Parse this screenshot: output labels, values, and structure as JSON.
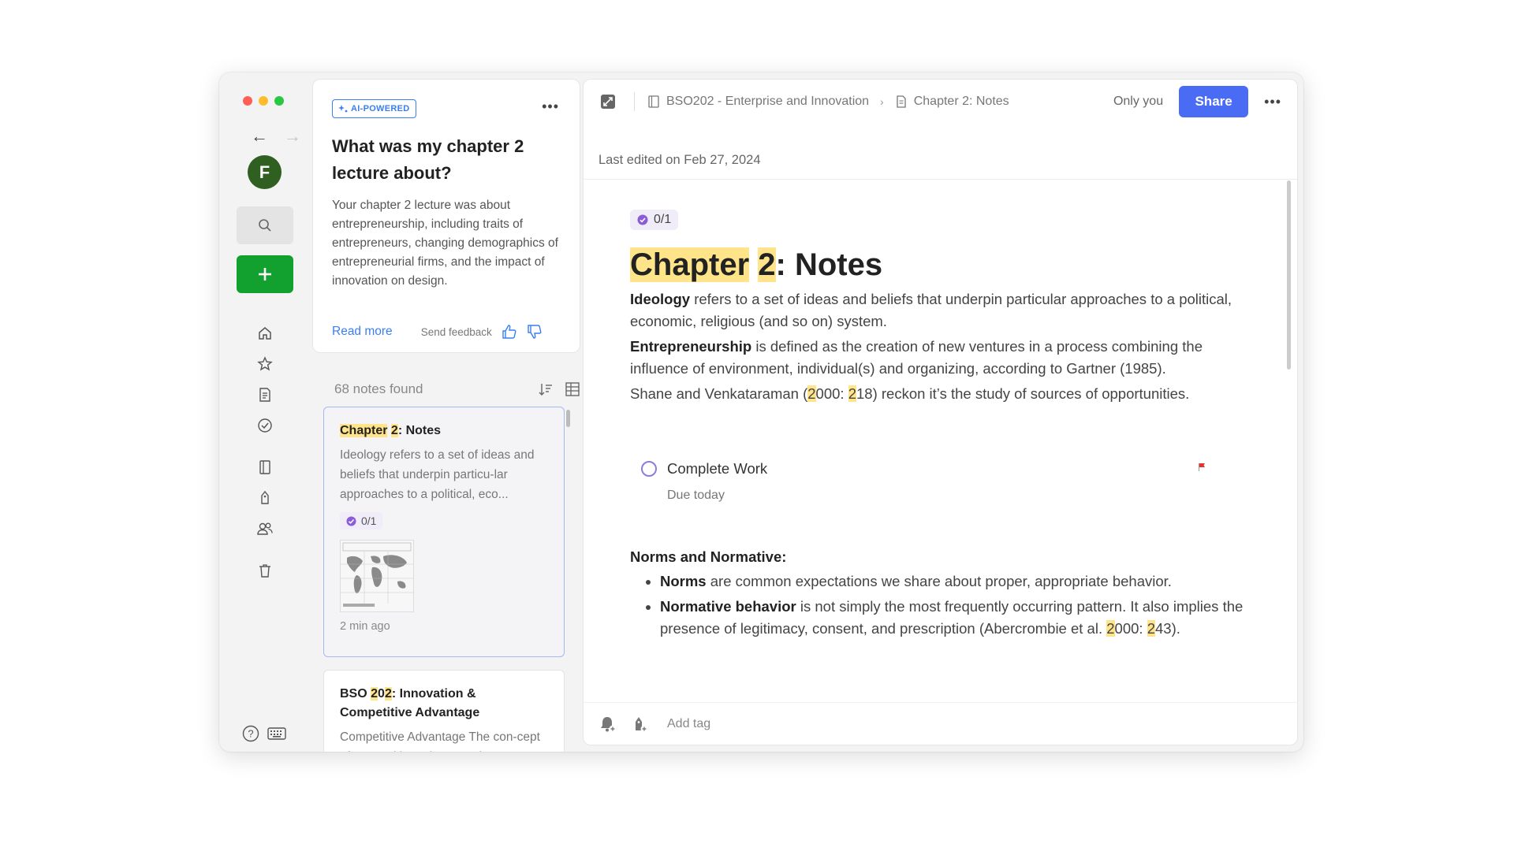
{
  "window": {
    "controls": [
      "close",
      "minimize",
      "zoom"
    ]
  },
  "rail": {
    "avatar_letter": "F",
    "nav": [
      "home",
      "shortcuts",
      "notes",
      "tasks",
      "notebooks",
      "tags",
      "shared",
      "trash"
    ]
  },
  "ai_card": {
    "badge": "AI-POWERED",
    "question": "What was my chapter 2 lecture about?",
    "answer": "Your chapter 2 lecture was about entrepreneurship, including traits of entrepreneurs, changing demographics of entrepreneurial firms, and the impact of innovation on design.",
    "read_more": "Read more",
    "send_feedback": "Send feedback"
  },
  "notes_list": {
    "count": "68 notes found",
    "items": [
      {
        "title_parts": [
          "Chapter",
          " ",
          "2",
          ": Notes"
        ],
        "snippet": "Ideology refers to a set of ideas and beliefs that underpin particu-lar approaches to a political, eco...",
        "progress": "0/1",
        "time": "2 min ago"
      },
      {
        "title_parts": [
          "BSO ",
          "2",
          "0",
          "2",
          ": Innovation & Competitive Advantage"
        ],
        "snippet": "Competitive Advantage The con-cept of competitive advantage is..."
      }
    ]
  },
  "editor": {
    "breadcrumb": {
      "notebook": "BSO202 - Enterprise and Innovation",
      "note": "Chapter 2: Notes"
    },
    "visibility": "Only you",
    "share_label": "Share",
    "last_edited": "Last edited on Feb 27, 2024",
    "task_progress": "0/1",
    "title_parts": [
      "Chapter",
      " ",
      "2",
      ": Notes"
    ],
    "para1": {
      "term": "Ideology",
      "text": " refers to a set of ideas and beliefs that underpin particular approaches to a political, economic, religious (and so on) system."
    },
    "para2": {
      "term": "Entrepreneurship",
      "text": " is defined as the creation of new ventures in a process combining the influence of environment, individual(s) and organizing, according to Gartner (1985)."
    },
    "para3": {
      "a": "Shane and Venkataraman (",
      "h1": "2",
      "b": "000: ",
      "h2": "2",
      "c": "18) reckon it’s the study of sources of opportunities."
    },
    "task": {
      "label": "Complete Work",
      "due": "Due today",
      "flag_color": "#e5322d"
    },
    "section_heading": "Norms and Normative:",
    "bullets": {
      "b1": {
        "term": "Norms",
        "text": " are common expectations we share about proper, appropriate behavior."
      },
      "b2": {
        "term": "Normative behavior",
        "text": " is not simply the most frequently occurring pattern. It also implies the presence of legitimacy, consent, and prescription (Abercrombie et al. ",
        "h1": "2",
        "mid": "000: ",
        "h2": "2",
        "end": "43)."
      }
    },
    "add_tag": "Add tag"
  },
  "colors": {
    "accent": "#4a6cf5",
    "new_button": "#12a12f",
    "highlight": "#ffe48a",
    "avatar": "#2f5f21"
  }
}
